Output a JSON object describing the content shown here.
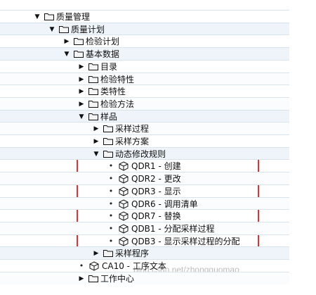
{
  "tree": {
    "nodes": [
      {
        "label": "质量管理",
        "level": 0,
        "state": "expanded",
        "icon": "folder-icon"
      },
      {
        "label": "质量计划",
        "level": 1,
        "state": "expanded",
        "icon": "folder-icon"
      },
      {
        "label": "检验计划",
        "level": 2,
        "state": "collapsed",
        "icon": "folder-icon"
      },
      {
        "label": "基本数据",
        "level": 2,
        "state": "expanded",
        "icon": "folder-icon"
      },
      {
        "label": "目录",
        "level": 3,
        "state": "collapsed",
        "icon": "folder-icon"
      },
      {
        "label": "检验特性",
        "level": 3,
        "state": "collapsed",
        "icon": "folder-icon"
      },
      {
        "label": "类特性",
        "level": 3,
        "state": "collapsed",
        "icon": "folder-icon"
      },
      {
        "label": "检验方法",
        "level": 3,
        "state": "collapsed",
        "icon": "folder-icon"
      },
      {
        "label": "样品",
        "level": 3,
        "state": "expanded",
        "icon": "folder-icon"
      },
      {
        "label": "采样过程",
        "level": 4,
        "state": "collapsed",
        "icon": "folder-icon"
      },
      {
        "label": "采样方案",
        "level": 4,
        "state": "collapsed",
        "icon": "folder-icon"
      },
      {
        "label": "动态修改规则",
        "level": 4,
        "state": "expanded",
        "icon": "folder-icon"
      },
      {
        "label": "QDR1 - 创建",
        "level": 5,
        "state": "leaf",
        "icon": "transaction-icon"
      },
      {
        "label": "QDR2 - 更改",
        "level": 5,
        "state": "leaf",
        "icon": "transaction-icon"
      },
      {
        "label": "QDR3 - 显示",
        "level": 5,
        "state": "leaf",
        "icon": "transaction-icon"
      },
      {
        "label": "QDR6 - 调用清单",
        "level": 5,
        "state": "leaf",
        "icon": "transaction-icon"
      },
      {
        "label": "QDR7 - 替换",
        "level": 5,
        "state": "leaf",
        "icon": "transaction-icon"
      },
      {
        "label": "QDB1 - 分配采样过程",
        "level": 5,
        "state": "leaf",
        "icon": "transaction-icon"
      },
      {
        "label": "QDB3 - 显示采样过程的分配",
        "level": 5,
        "state": "leaf",
        "icon": "transaction-icon"
      },
      {
        "label": "采样程序",
        "level": 4,
        "state": "collapsed",
        "icon": "folder-icon"
      },
      {
        "label": "CA10 - 工序文本",
        "level": 3,
        "state": "leaf",
        "icon": "transaction-icon"
      },
      {
        "label": "工作中心",
        "level": 3,
        "state": "collapsed",
        "icon": "folder-icon"
      }
    ]
  },
  "watermark": "blog.csdn.net/zhongguomao",
  "colors": {
    "folder_fill": "#f4f4f4",
    "folder_stroke": "#111111",
    "highlight": "#e53030",
    "row_alt": "#eef4f9"
  }
}
